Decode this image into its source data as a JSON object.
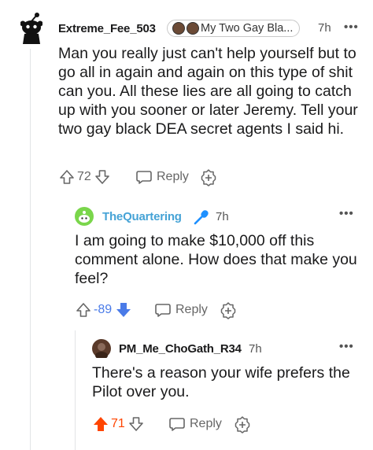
{
  "comments": [
    {
      "username": "Extreme_Fee_503",
      "flair": "My Two Gay Bla...",
      "time": "7h",
      "body": "Man you really just can't help yourself but to go all in again and again on this type of shit can you. All these lies are all going to catch up with you sooner or later Jeremy. Tell your two gay black DEA secret agents I said hi.",
      "score": "72",
      "reply_label": "Reply"
    },
    {
      "username": "TheQuartering",
      "time": "7h",
      "body": "I am going to make $10,000 off this comment alone. How does that make you feel?",
      "score": "-89",
      "reply_label": "Reply"
    },
    {
      "username": "PM_Me_ChoGath_R34",
      "time": "7h",
      "body": "There's a reason your wife prefers the Pilot over you.",
      "score": "71",
      "reply_label": "Reply"
    }
  ],
  "more_label": "•••",
  "colors": {
    "upvote": "#ff4500",
    "downvote": "#4a7be8",
    "mod_username": "#46a3d6",
    "text": "#1a1a1b",
    "muted": "#666666"
  }
}
